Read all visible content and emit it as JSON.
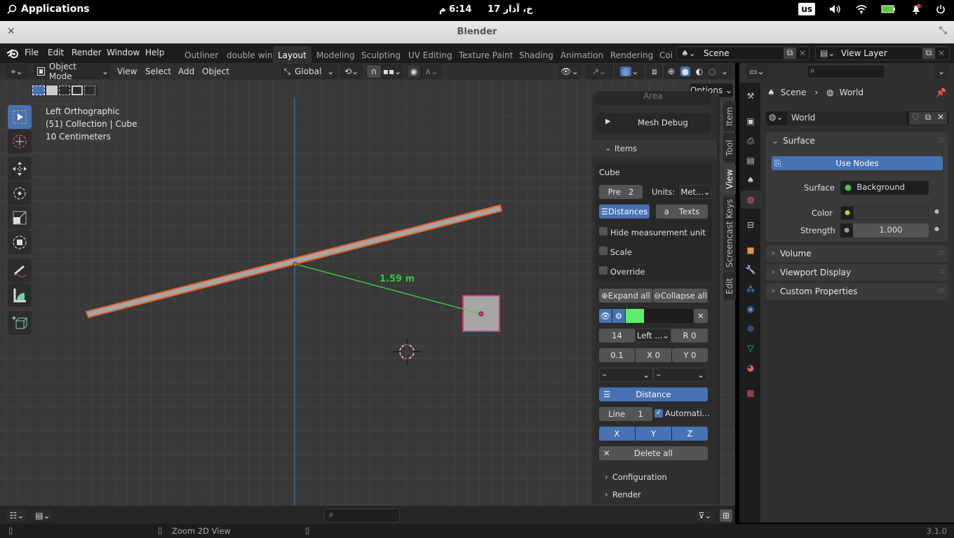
{
  "system": {
    "applications": "Applications",
    "date": "خ، آذار 17",
    "time": "6:14 م",
    "keyboard_layout": "us"
  },
  "window": {
    "title": "Blender"
  },
  "menubar": {
    "menus": [
      "File",
      "Edit",
      "Render",
      "Window",
      "Help"
    ],
    "workspaces": [
      "Outliner",
      "double win",
      "Layout",
      "Modeling",
      "Sculpting",
      "UV Editing",
      "Texture Paint",
      "Shading",
      "Animation",
      "Rendering",
      "Coi"
    ],
    "active_workspace": "Layout",
    "scene": "Scene",
    "view_layer": "View Layer"
  },
  "viewport_header": {
    "mode": "Object Mode",
    "menus": [
      "View",
      "Select",
      "Add",
      "Object"
    ],
    "orientation": "Global",
    "options": "Options"
  },
  "viewport": {
    "view_name": "Left Orthographic",
    "collection": "(51) Collection | Cube",
    "scale": "10 Centimeters",
    "measurement": "1.59 m",
    "measure_color": "#38c43a"
  },
  "npanel": {
    "tabs": [
      "Item",
      "Tool",
      "View",
      "Screencast Keys",
      "Edit"
    ],
    "active_tab": "View",
    "area_label": "Area",
    "mesh_debug": "Mesh Debug",
    "items_label": "Items",
    "object_name": "Cube",
    "precision_label": "Pre",
    "precision_value": "2",
    "units_label": "Units:",
    "units_value": "Met...",
    "distances": "Distances",
    "texts": "Texts",
    "hide_unit": "Hide measurement unit",
    "scale": "Scale",
    "override": "Override",
    "expand_all": "Expand all",
    "collapse_all": "Collapse all",
    "item_color": "#5ef06c",
    "font_size": "14",
    "align": "Left ...",
    "rotation": "R  0",
    "line_width": "0.1",
    "offset_x": "X  0",
    "offset_y": "Y  0",
    "dropdown_a": "–",
    "dropdown_b": "–",
    "distance_type": "Distance",
    "line_label": "Line",
    "line_value": "1",
    "automatic": "Automati...",
    "automatic_checked": true,
    "axis_x": "X",
    "axis_y": "Y",
    "axis_z": "Z",
    "delete_all": "Delete all",
    "configuration": "Configuration",
    "render": "Render"
  },
  "properties": {
    "breadcrumb_scene": "Scene",
    "breadcrumb_world": "World",
    "world_name": "World",
    "surface_panel": "Surface",
    "use_nodes": "Use Nodes",
    "surface_label": "Surface",
    "surface_value": "Background",
    "color_label": "Color",
    "strength_label": "Strength",
    "strength_value": "1.000",
    "volume": "Volume",
    "viewport_display": "Viewport Display",
    "custom_properties": "Custom Properties"
  },
  "statusbar": {
    "hint": "Zoom 2D View",
    "version": "3.1.0"
  }
}
